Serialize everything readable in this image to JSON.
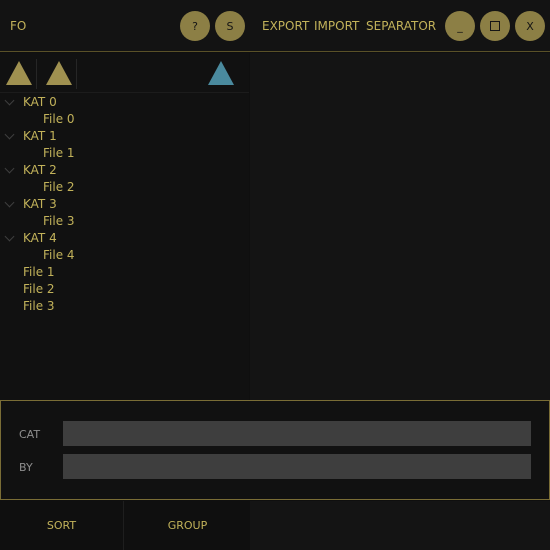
{
  "header": {
    "title": "FO",
    "help_label": "?",
    "s_label": "S",
    "menu": [
      "EXPORT",
      "IMPORT",
      "SEPARATOR"
    ],
    "minimize_label": "_",
    "close_label": "X"
  },
  "toolbar": {
    "icons": [
      "triangle-up-icon",
      "triangle-up-icon",
      "triangle-up-icon"
    ]
  },
  "tree": {
    "categories": [
      {
        "label": "KAT 0",
        "file": "File 0"
      },
      {
        "label": "KAT 1",
        "file": "File 1"
      },
      {
        "label": "KAT 2",
        "file": "File 2"
      },
      {
        "label": "KAT 3",
        "file": "File 3"
      },
      {
        "label": "KAT 4",
        "file": "File 4"
      }
    ],
    "root_files": [
      "File 1",
      "File 2",
      "File 3"
    ]
  },
  "form": {
    "cat_label": "CAT",
    "cat_value": "",
    "by_label": "BY",
    "by_value": ""
  },
  "footer": {
    "sort_label": "SORT",
    "group_label": "GROUP"
  },
  "colors": {
    "accent": "#c2b25a",
    "button_fill": "#8c7f45",
    "triangle": "#a09150",
    "triangle_blue": "#4a8a9e"
  }
}
